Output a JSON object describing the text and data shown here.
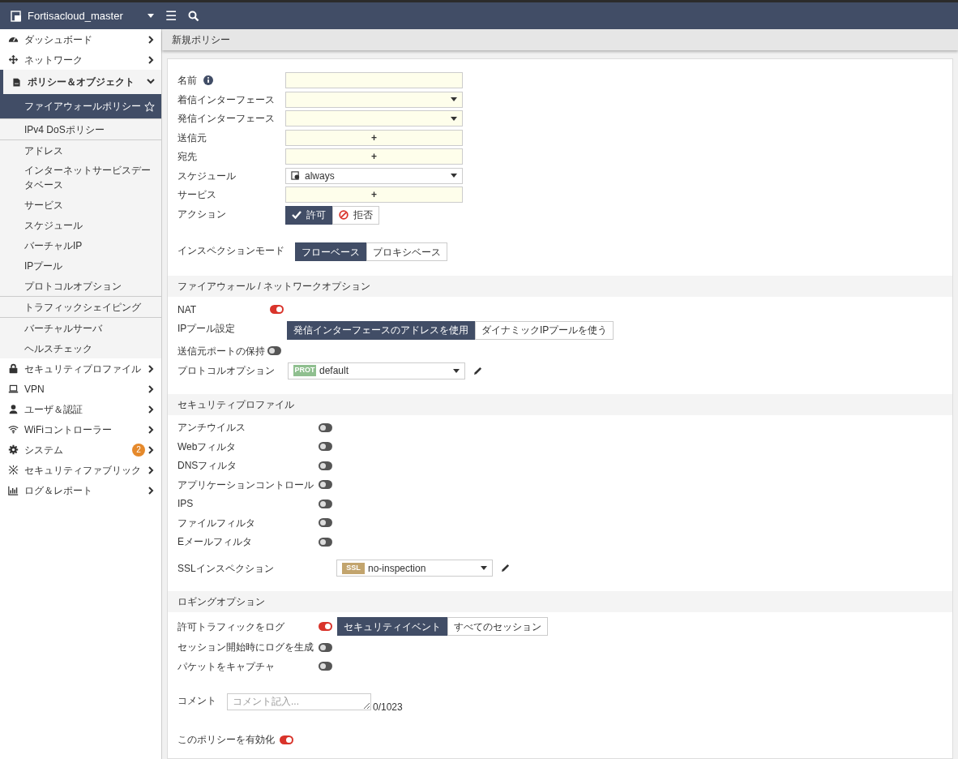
{
  "header": {
    "title": "Fortisacloud_master",
    "menu_glyph": "☰"
  },
  "sidebar": {
    "items": [
      {
        "label": "ダッシュボード",
        "expanded": false
      },
      {
        "label": "ネットワーク",
        "expanded": false
      },
      {
        "label": "ポリシー＆オブジェクト",
        "expanded": true,
        "sections": [
          {
            "items": [
              {
                "label": "ファイアウォールポリシー",
                "selected": true
              }
            ]
          },
          {
            "items": [
              {
                "label": "IPv4 DoSポリシー",
                "selected": false
              }
            ]
          },
          {
            "items": [
              {
                "label": "アドレス",
                "selected": false
              },
              {
                "label": "インターネットサービスデータベース",
                "selected": false
              },
              {
                "label": "サービス",
                "selected": false
              },
              {
                "label": "スケジュール",
                "selected": false
              },
              {
                "label": "バーチャルIP",
                "selected": false
              },
              {
                "label": "IPプール",
                "selected": false
              },
              {
                "label": "プロトコルオプション",
                "selected": false
              }
            ]
          },
          {
            "items": [
              {
                "label": "トラフィックシェイピング",
                "selected": false
              }
            ]
          },
          {
            "items": [
              {
                "label": "バーチャルサーバ",
                "selected": false
              },
              {
                "label": "ヘルスチェック",
                "selected": false
              }
            ]
          }
        ]
      },
      {
        "label": "セキュリティプロファイル",
        "expanded": false
      },
      {
        "label": "VPN",
        "expanded": false
      },
      {
        "label": "ユーザ＆認証",
        "expanded": false
      },
      {
        "label": "WiFiコントローラー",
        "expanded": false
      },
      {
        "label": "システム",
        "expanded": false,
        "badge": "2"
      },
      {
        "label": "セキュリティファブリック",
        "expanded": false
      },
      {
        "label": "ログ＆レポート",
        "expanded": false
      }
    ]
  },
  "breadcrumb": "新規ポリシー",
  "form": {
    "fields": [
      {
        "kind": "text",
        "label": "名前",
        "info": true
      },
      {
        "kind": "select",
        "label": "着信インターフェース"
      },
      {
        "kind": "select",
        "label": "発信インターフェース"
      },
      {
        "kind": "add",
        "label": "送信元",
        "symbol": "+"
      },
      {
        "kind": "add",
        "label": "宛先",
        "symbol": "+"
      },
      {
        "kind": "select",
        "label": "スケジュール",
        "value": "always"
      },
      {
        "kind": "add",
        "label": "サービス",
        "symbol": "+"
      },
      {
        "kind": "segmented",
        "label": "アクション",
        "options": [
          {
            "label": "許可",
            "selected": true
          },
          {
            "label": "拒否",
            "selected": false
          }
        ]
      },
      {
        "kind": "segmented",
        "label": "インスペクションモード",
        "options": [
          {
            "label": "フローベース",
            "selected": true
          },
          {
            "label": "プロキシベース",
            "selected": false
          }
        ]
      }
    ]
  },
  "sections": [
    {
      "title": "ファイアウォール / ネットワークオプション",
      "rows": [
        {
          "kind": "toggle",
          "label": "NAT",
          "on": true
        },
        {
          "kind": "segmented",
          "label": "IPプール設定",
          "options": [
            {
              "label": "発信インターフェースのアドレスを使用",
              "selected": true
            },
            {
              "label": "ダイナミックIPプールを使う",
              "selected": false
            }
          ]
        },
        {
          "kind": "toggle",
          "label": "送信元ポートの保持",
          "on": false
        },
        {
          "kind": "profile",
          "label": "プロトコルオプション",
          "tag": "PROT",
          "color": "#8fbf8f",
          "value": "default"
        }
      ]
    },
    {
      "title": "セキュリティプロファイル",
      "rows": [
        {
          "kind": "toggle",
          "label": "アンチウイルス",
          "on": false
        },
        {
          "kind": "toggle",
          "label": "Webフィルタ",
          "on": false
        },
        {
          "kind": "toggle",
          "label": "DNSフィルタ",
          "on": false
        },
        {
          "kind": "toggle",
          "label": "アプリケーションコントロール",
          "on": false
        },
        {
          "kind": "toggle",
          "label": "IPS",
          "on": false
        },
        {
          "kind": "toggle",
          "label": "ファイルフィルタ",
          "on": false
        },
        {
          "kind": "toggle",
          "label": "Eメールフィルタ",
          "on": false
        },
        {
          "kind": "profile",
          "label": "SSLインスペクション",
          "tag": "SSL",
          "color": "#c2a46d",
          "value": "no-inspection"
        }
      ]
    },
    {
      "title": "ロギングオプション",
      "rows": [
        {
          "kind": "toggle",
          "label": "許可トラフィックをログ",
          "on": true,
          "options": [
            {
              "label": "セキュリティイベント",
              "selected": true
            },
            {
              "label": "すべてのセッション",
              "selected": false
            }
          ]
        },
        {
          "kind": "toggle",
          "label": "セッション開始時にログを生成",
          "on": false
        },
        {
          "kind": "toggle",
          "label": "パケットをキャプチャ",
          "on": false
        }
      ]
    }
  ],
  "comment": {
    "label": "コメント",
    "placeholder": "コメント記入...",
    "counter": "0/1023"
  },
  "enable": {
    "label": "このポリシーを有効化",
    "on": true
  }
}
